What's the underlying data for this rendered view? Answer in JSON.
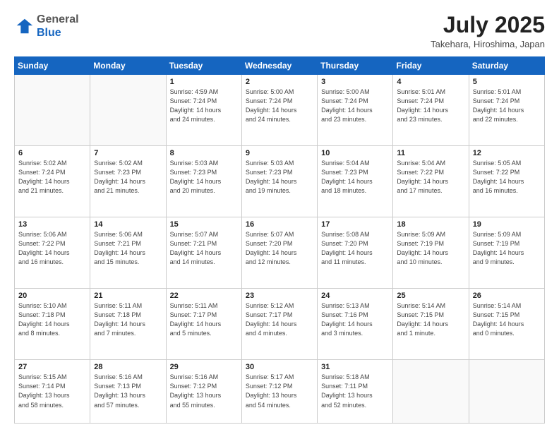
{
  "header": {
    "logo_general": "General",
    "logo_blue": "Blue",
    "month_title": "July 2025",
    "location": "Takehara, Hiroshima, Japan"
  },
  "weekdays": [
    "Sunday",
    "Monday",
    "Tuesday",
    "Wednesday",
    "Thursday",
    "Friday",
    "Saturday"
  ],
  "weeks": [
    [
      {
        "day": "",
        "info": ""
      },
      {
        "day": "",
        "info": ""
      },
      {
        "day": "1",
        "info": "Sunrise: 4:59 AM\nSunset: 7:24 PM\nDaylight: 14 hours\nand 24 minutes."
      },
      {
        "day": "2",
        "info": "Sunrise: 5:00 AM\nSunset: 7:24 PM\nDaylight: 14 hours\nand 24 minutes."
      },
      {
        "day": "3",
        "info": "Sunrise: 5:00 AM\nSunset: 7:24 PM\nDaylight: 14 hours\nand 23 minutes."
      },
      {
        "day": "4",
        "info": "Sunrise: 5:01 AM\nSunset: 7:24 PM\nDaylight: 14 hours\nand 23 minutes."
      },
      {
        "day": "5",
        "info": "Sunrise: 5:01 AM\nSunset: 7:24 PM\nDaylight: 14 hours\nand 22 minutes."
      }
    ],
    [
      {
        "day": "6",
        "info": "Sunrise: 5:02 AM\nSunset: 7:24 PM\nDaylight: 14 hours\nand 21 minutes."
      },
      {
        "day": "7",
        "info": "Sunrise: 5:02 AM\nSunset: 7:23 PM\nDaylight: 14 hours\nand 21 minutes."
      },
      {
        "day": "8",
        "info": "Sunrise: 5:03 AM\nSunset: 7:23 PM\nDaylight: 14 hours\nand 20 minutes."
      },
      {
        "day": "9",
        "info": "Sunrise: 5:03 AM\nSunset: 7:23 PM\nDaylight: 14 hours\nand 19 minutes."
      },
      {
        "day": "10",
        "info": "Sunrise: 5:04 AM\nSunset: 7:23 PM\nDaylight: 14 hours\nand 18 minutes."
      },
      {
        "day": "11",
        "info": "Sunrise: 5:04 AM\nSunset: 7:22 PM\nDaylight: 14 hours\nand 17 minutes."
      },
      {
        "day": "12",
        "info": "Sunrise: 5:05 AM\nSunset: 7:22 PM\nDaylight: 14 hours\nand 16 minutes."
      }
    ],
    [
      {
        "day": "13",
        "info": "Sunrise: 5:06 AM\nSunset: 7:22 PM\nDaylight: 14 hours\nand 16 minutes."
      },
      {
        "day": "14",
        "info": "Sunrise: 5:06 AM\nSunset: 7:21 PM\nDaylight: 14 hours\nand 15 minutes."
      },
      {
        "day": "15",
        "info": "Sunrise: 5:07 AM\nSunset: 7:21 PM\nDaylight: 14 hours\nand 14 minutes."
      },
      {
        "day": "16",
        "info": "Sunrise: 5:07 AM\nSunset: 7:20 PM\nDaylight: 14 hours\nand 12 minutes."
      },
      {
        "day": "17",
        "info": "Sunrise: 5:08 AM\nSunset: 7:20 PM\nDaylight: 14 hours\nand 11 minutes."
      },
      {
        "day": "18",
        "info": "Sunrise: 5:09 AM\nSunset: 7:19 PM\nDaylight: 14 hours\nand 10 minutes."
      },
      {
        "day": "19",
        "info": "Sunrise: 5:09 AM\nSunset: 7:19 PM\nDaylight: 14 hours\nand 9 minutes."
      }
    ],
    [
      {
        "day": "20",
        "info": "Sunrise: 5:10 AM\nSunset: 7:18 PM\nDaylight: 14 hours\nand 8 minutes."
      },
      {
        "day": "21",
        "info": "Sunrise: 5:11 AM\nSunset: 7:18 PM\nDaylight: 14 hours\nand 7 minutes."
      },
      {
        "day": "22",
        "info": "Sunrise: 5:11 AM\nSunset: 7:17 PM\nDaylight: 14 hours\nand 5 minutes."
      },
      {
        "day": "23",
        "info": "Sunrise: 5:12 AM\nSunset: 7:17 PM\nDaylight: 14 hours\nand 4 minutes."
      },
      {
        "day": "24",
        "info": "Sunrise: 5:13 AM\nSunset: 7:16 PM\nDaylight: 14 hours\nand 3 minutes."
      },
      {
        "day": "25",
        "info": "Sunrise: 5:14 AM\nSunset: 7:15 PM\nDaylight: 14 hours\nand 1 minute."
      },
      {
        "day": "26",
        "info": "Sunrise: 5:14 AM\nSunset: 7:15 PM\nDaylight: 14 hours\nand 0 minutes."
      }
    ],
    [
      {
        "day": "27",
        "info": "Sunrise: 5:15 AM\nSunset: 7:14 PM\nDaylight: 13 hours\nand 58 minutes."
      },
      {
        "day": "28",
        "info": "Sunrise: 5:16 AM\nSunset: 7:13 PM\nDaylight: 13 hours\nand 57 minutes."
      },
      {
        "day": "29",
        "info": "Sunrise: 5:16 AM\nSunset: 7:12 PM\nDaylight: 13 hours\nand 55 minutes."
      },
      {
        "day": "30",
        "info": "Sunrise: 5:17 AM\nSunset: 7:12 PM\nDaylight: 13 hours\nand 54 minutes."
      },
      {
        "day": "31",
        "info": "Sunrise: 5:18 AM\nSunset: 7:11 PM\nDaylight: 13 hours\nand 52 minutes."
      },
      {
        "day": "",
        "info": ""
      },
      {
        "day": "",
        "info": ""
      }
    ]
  ]
}
